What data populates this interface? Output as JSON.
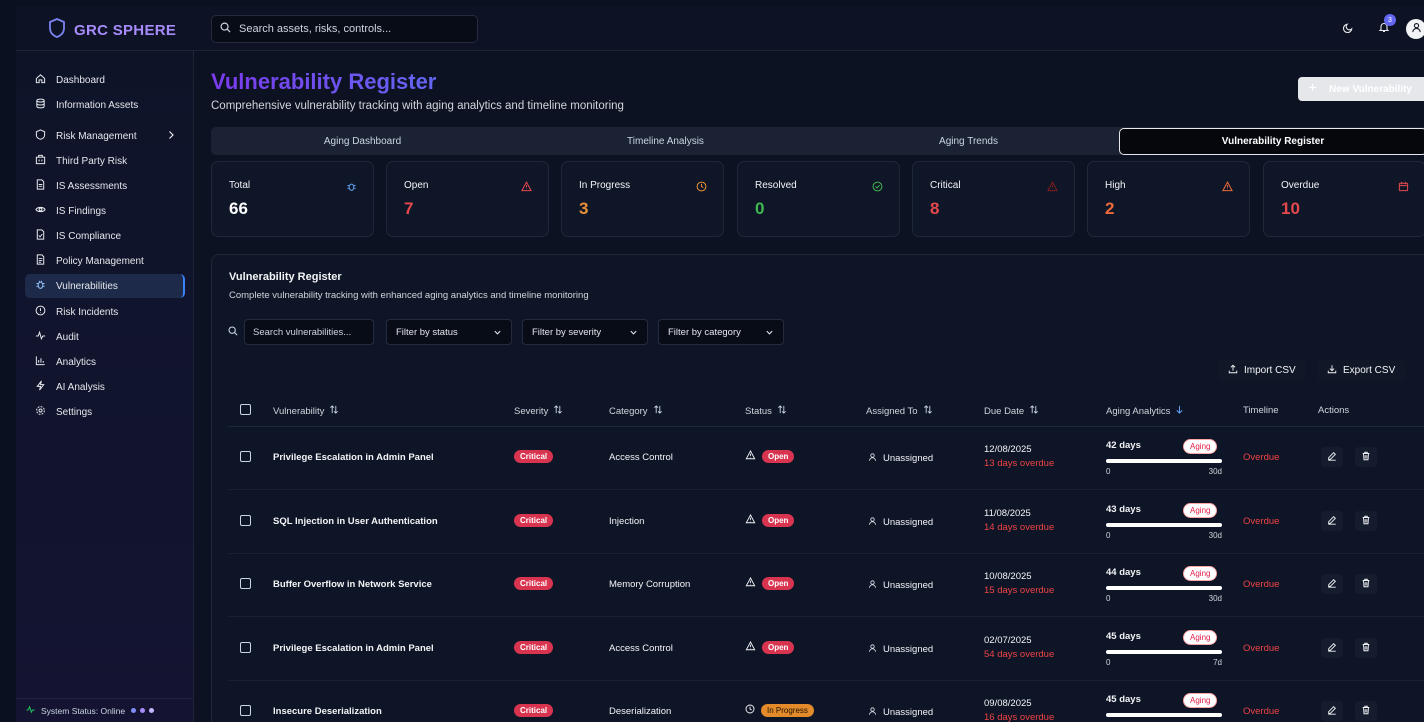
{
  "app": {
    "brand": "GRC SPHERE",
    "search_placeholder": "Search assets, risks, controls...",
    "notification_count": "3"
  },
  "sidebar": {
    "items": [
      {
        "label": "Dashboard"
      },
      {
        "label": "Information Assets"
      },
      {
        "label": "Risk Management"
      },
      {
        "label": "Third Party Risk"
      },
      {
        "label": "IS Assessments"
      },
      {
        "label": "IS Findings"
      },
      {
        "label": "IS Compliance"
      },
      {
        "label": "Policy Management"
      },
      {
        "label": "Vulnerabilities"
      },
      {
        "label": "Risk Incidents"
      },
      {
        "label": "Audit"
      },
      {
        "label": "Analytics"
      },
      {
        "label": "AI Analysis"
      },
      {
        "label": "Settings"
      }
    ],
    "system_status": "System Status: Online"
  },
  "page": {
    "title": "Vulnerability Register",
    "subtitle": "Comprehensive vulnerability tracking with aging analytics and timeline monitoring",
    "new_button": "New Vulnerability"
  },
  "tabs": [
    {
      "label": "Aging Dashboard"
    },
    {
      "label": "Timeline Analysis"
    },
    {
      "label": "Aging Trends"
    },
    {
      "label": "Vulnerability Register"
    }
  ],
  "stats": [
    {
      "label": "Total",
      "value": "66",
      "color": "#ffffff"
    },
    {
      "label": "Open",
      "value": "7",
      "color": "#e5484d"
    },
    {
      "label": "In Progress",
      "value": "3",
      "color": "#e8913a"
    },
    {
      "label": "Resolved",
      "value": "0",
      "color": "#3fb950"
    },
    {
      "label": "Critical",
      "value": "8",
      "color": "#e5484d"
    },
    {
      "label": "High",
      "value": "2",
      "color": "#ef6a3a"
    },
    {
      "label": "Overdue",
      "value": "10",
      "color": "#e5484d"
    }
  ],
  "register": {
    "title": "Vulnerability Register",
    "subtitle": "Complete vulnerability tracking with enhanced aging analytics and timeline monitoring",
    "search_placeholder": "Search vulnerabilities...",
    "filters": {
      "status": "Filter by status",
      "severity": "Filter by severity",
      "category": "Filter by category"
    },
    "import_label": "Import CSV",
    "export_label": "Export CSV",
    "columns": {
      "vulnerability": "Vulnerability",
      "severity": "Severity",
      "category": "Category",
      "status": "Status",
      "assigned": "Assigned To",
      "due": "Due Date",
      "aging": "Aging Analytics",
      "timeline": "Timeline",
      "actions": "Actions"
    },
    "rows": [
      {
        "name": "Privilege Escalation in Admin Panel",
        "severity": "Critical",
        "category": "Access Control",
        "status": "Open",
        "assigned": "Unassigned",
        "due_date": "12/08/2025",
        "overdue": "13 days overdue",
        "age": "42 days",
        "aging_badge": "Aging",
        "bar_min": "0",
        "bar_max": "30d",
        "timeline": "Overdue",
        "progress": 1.0
      },
      {
        "name": "SQL Injection in User Authentication",
        "severity": "Critical",
        "category": "Injection",
        "status": "Open",
        "assigned": "Unassigned",
        "due_date": "11/08/2025",
        "overdue": "14 days overdue",
        "age": "43 days",
        "aging_badge": "Aging",
        "bar_min": "0",
        "bar_max": "30d",
        "timeline": "Overdue",
        "progress": 1.0
      },
      {
        "name": "Buffer Overflow in Network Service",
        "severity": "Critical",
        "category": "Memory Corruption",
        "status": "Open",
        "assigned": "Unassigned",
        "due_date": "10/08/2025",
        "overdue": "15 days overdue",
        "age": "44 days",
        "aging_badge": "Aging",
        "bar_min": "0",
        "bar_max": "30d",
        "timeline": "Overdue",
        "progress": 1.0
      },
      {
        "name": "Privilege Escalation in Admin Panel",
        "severity": "Critical",
        "category": "Access Control",
        "status": "Open",
        "assigned": "Unassigned",
        "due_date": "02/07/2025",
        "overdue": "54 days overdue",
        "age": "45 days",
        "aging_badge": "Aging",
        "bar_min": "0",
        "bar_max": "7d",
        "timeline": "Overdue",
        "progress": 1.0
      },
      {
        "name": "Insecure Deserialization",
        "severity": "Critical",
        "category": "Deserialization",
        "status": "In Progress",
        "assigned": "Unassigned",
        "due_date": "09/08/2025",
        "overdue": "16 days overdue",
        "age": "45 days",
        "aging_badge": "Aging",
        "bar_min": "0",
        "bar_max": "",
        "timeline": "Overdue",
        "progress": 1.0
      }
    ]
  }
}
